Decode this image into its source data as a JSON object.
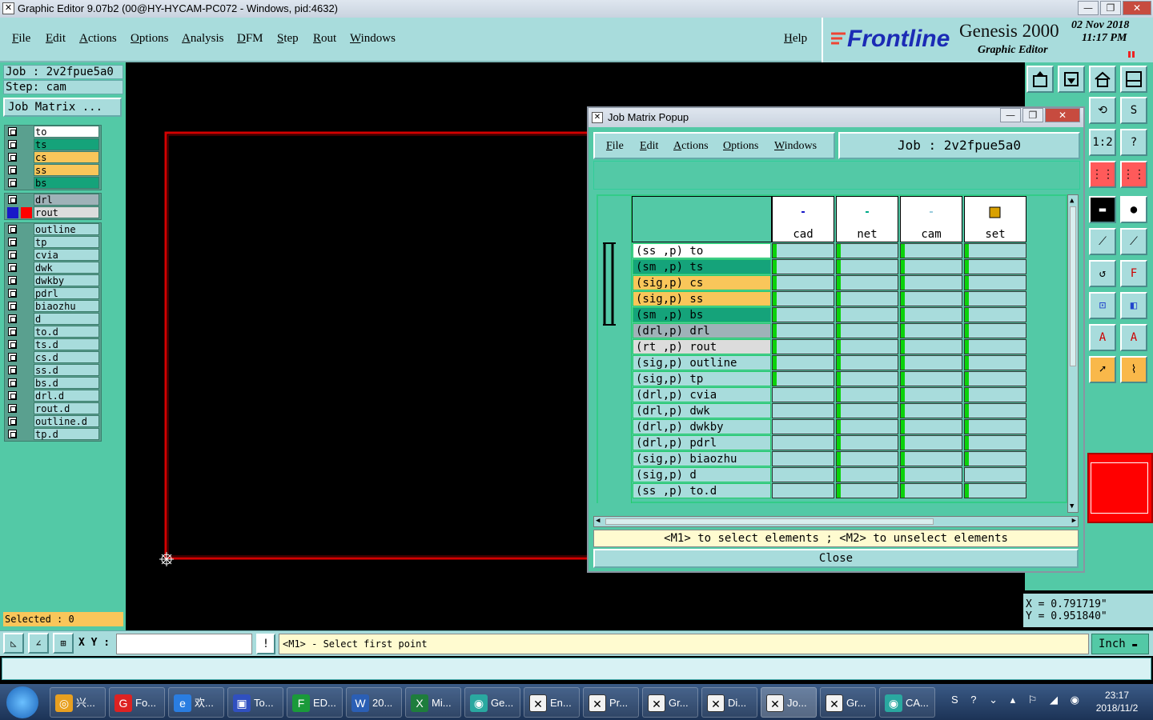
{
  "window": {
    "title": "Graphic Editor 9.07b2 (00@HY-HYCAM-PC072 - Windows, pid:4632)",
    "minimize": "—",
    "restore": "❐",
    "close": "✕"
  },
  "menu": [
    "File",
    "Edit",
    "Actions",
    "Options",
    "Analysis",
    "DFM",
    "Step",
    "Rout",
    "Windows"
  ],
  "help": "Help",
  "brand": {
    "logo": "Frontline",
    "product": "Genesis 2000",
    "subtitle": "Graphic Editor",
    "date": "02 Nov 2018",
    "time": "11:17 PM"
  },
  "left": {
    "job": "Job : 2v2fpue5a0",
    "step": "Step: cam",
    "job_matrix_btn": "Job Matrix ..."
  },
  "layers_group1": [
    {
      "name": "to",
      "color": "#ffffff"
    },
    {
      "name": "ts",
      "color": "#15a37a"
    },
    {
      "name": "cs",
      "color": "#f9c65a"
    },
    {
      "name": "ss",
      "color": "#f9c65a"
    },
    {
      "name": "bs",
      "color": "#15a37a"
    }
  ],
  "layers_group2": [
    {
      "name": "drl",
      "color": "#9fb2b8"
    },
    {
      "name": "rout",
      "color": "#dcdcdc"
    }
  ],
  "layers_group3": [
    {
      "name": "outline"
    },
    {
      "name": "tp"
    },
    {
      "name": "cvia"
    },
    {
      "name": "dwk"
    },
    {
      "name": "dwkby"
    },
    {
      "name": "pdrl"
    },
    {
      "name": "biaozhu"
    },
    {
      "name": "d"
    },
    {
      "name": "to.d"
    },
    {
      "name": "ts.d"
    },
    {
      "name": "cs.d"
    },
    {
      "name": "ss.d"
    },
    {
      "name": "bs.d"
    },
    {
      "name": "drl.d"
    },
    {
      "name": "rout.d"
    },
    {
      "name": "outline.d"
    },
    {
      "name": "tp.d"
    }
  ],
  "selected": "Selected : 0",
  "coords": {
    "x": "X = 0.791719\"",
    "y": "Y = 0.951840\""
  },
  "status": {
    "xy_label": "X Y :",
    "xy_value": "",
    "message": "<M1> - Select first point",
    "units": "Inch"
  },
  "popup": {
    "title": "Job Matrix Popup",
    "menu": [
      "File",
      "Edit",
      "Actions",
      "Options",
      "Windows"
    ],
    "job": "Job : 2v2fpue5a0",
    "columns": [
      "cad",
      "net",
      "cam",
      "set"
    ],
    "rows": [
      {
        "label": "(ss ,p) to",
        "color": "#ffffff",
        "cells": [
          1,
          1,
          1,
          1
        ]
      },
      {
        "label": "(sm ,p) ts",
        "color": "#15a37a",
        "cells": [
          1,
          1,
          1,
          1
        ]
      },
      {
        "label": "(sig,p) cs",
        "color": "#f9c65a",
        "cells": [
          1,
          1,
          1,
          1
        ]
      },
      {
        "label": "(sig,p) ss",
        "color": "#f9c65a",
        "cells": [
          1,
          1,
          1,
          1
        ]
      },
      {
        "label": "(sm ,p) bs",
        "color": "#15a37a",
        "cells": [
          1,
          1,
          1,
          1
        ]
      },
      {
        "label": "(drl,p) drl",
        "color": "#9fb2b8",
        "cells": [
          1,
          1,
          1,
          1
        ]
      },
      {
        "label": "(rt ,p) rout",
        "color": "#dcdcdc",
        "cells": [
          1,
          1,
          1,
          1
        ]
      },
      {
        "label": "(sig,p) outline",
        "color": "#a8dcdc",
        "cells": [
          1,
          1,
          1,
          1
        ]
      },
      {
        "label": "(sig,p) tp",
        "color": "#a8dcdc",
        "cells": [
          1,
          1,
          1,
          1
        ]
      },
      {
        "label": "(drl,p) cvia",
        "color": "#a8dcdc",
        "cells": [
          0,
          1,
          1,
          1
        ]
      },
      {
        "label": "(drl,p) dwk",
        "color": "#a8dcdc",
        "cells": [
          0,
          1,
          1,
          1
        ]
      },
      {
        "label": "(drl,p) dwkby",
        "color": "#a8dcdc",
        "cells": [
          0,
          1,
          1,
          1
        ]
      },
      {
        "label": "(drl,p) pdrl",
        "color": "#a8dcdc",
        "cells": [
          0,
          1,
          1,
          1
        ]
      },
      {
        "label": "(sig,p) biaozhu",
        "color": "#a8dcdc",
        "cells": [
          0,
          1,
          1,
          1
        ]
      },
      {
        "label": "(sig,p) d",
        "color": "#a8dcdc",
        "cells": [
          0,
          1,
          1,
          0
        ]
      },
      {
        "label": "(ss ,p) to.d",
        "color": "#a8dcdc",
        "cells": [
          0,
          1,
          1,
          1
        ]
      }
    ],
    "hint": "<M1> to select elements ; <M2> to unselect elements",
    "close": "Close"
  },
  "taskbar": {
    "items": [
      {
        "label": "兴...",
        "icon": "shell-icon"
      },
      {
        "label": "Fo...",
        "icon": "foxit-icon"
      },
      {
        "label": "欢...",
        "icon": "ie-icon"
      },
      {
        "label": "To...",
        "icon": "save-icon"
      },
      {
        "label": "ED...",
        "icon": "f-icon"
      },
      {
        "label": "20...",
        "icon": "word-icon"
      },
      {
        "label": "Mi...",
        "icon": "excel-icon"
      },
      {
        "label": "Ge...",
        "icon": "genesis-icon"
      },
      {
        "label": "En...",
        "icon": "x-icon"
      },
      {
        "label": "Pr...",
        "icon": "x-icon"
      },
      {
        "label": "Gr...",
        "icon": "x-icon"
      },
      {
        "label": "Di...",
        "icon": "x-icon"
      },
      {
        "label": "Jo...",
        "icon": "x-icon"
      },
      {
        "label": "Gr...",
        "icon": "x-icon"
      },
      {
        "label": "CA...",
        "icon": "genesis-icon"
      }
    ],
    "clock_time": "23:17",
    "clock_date": "2018/11/2"
  }
}
